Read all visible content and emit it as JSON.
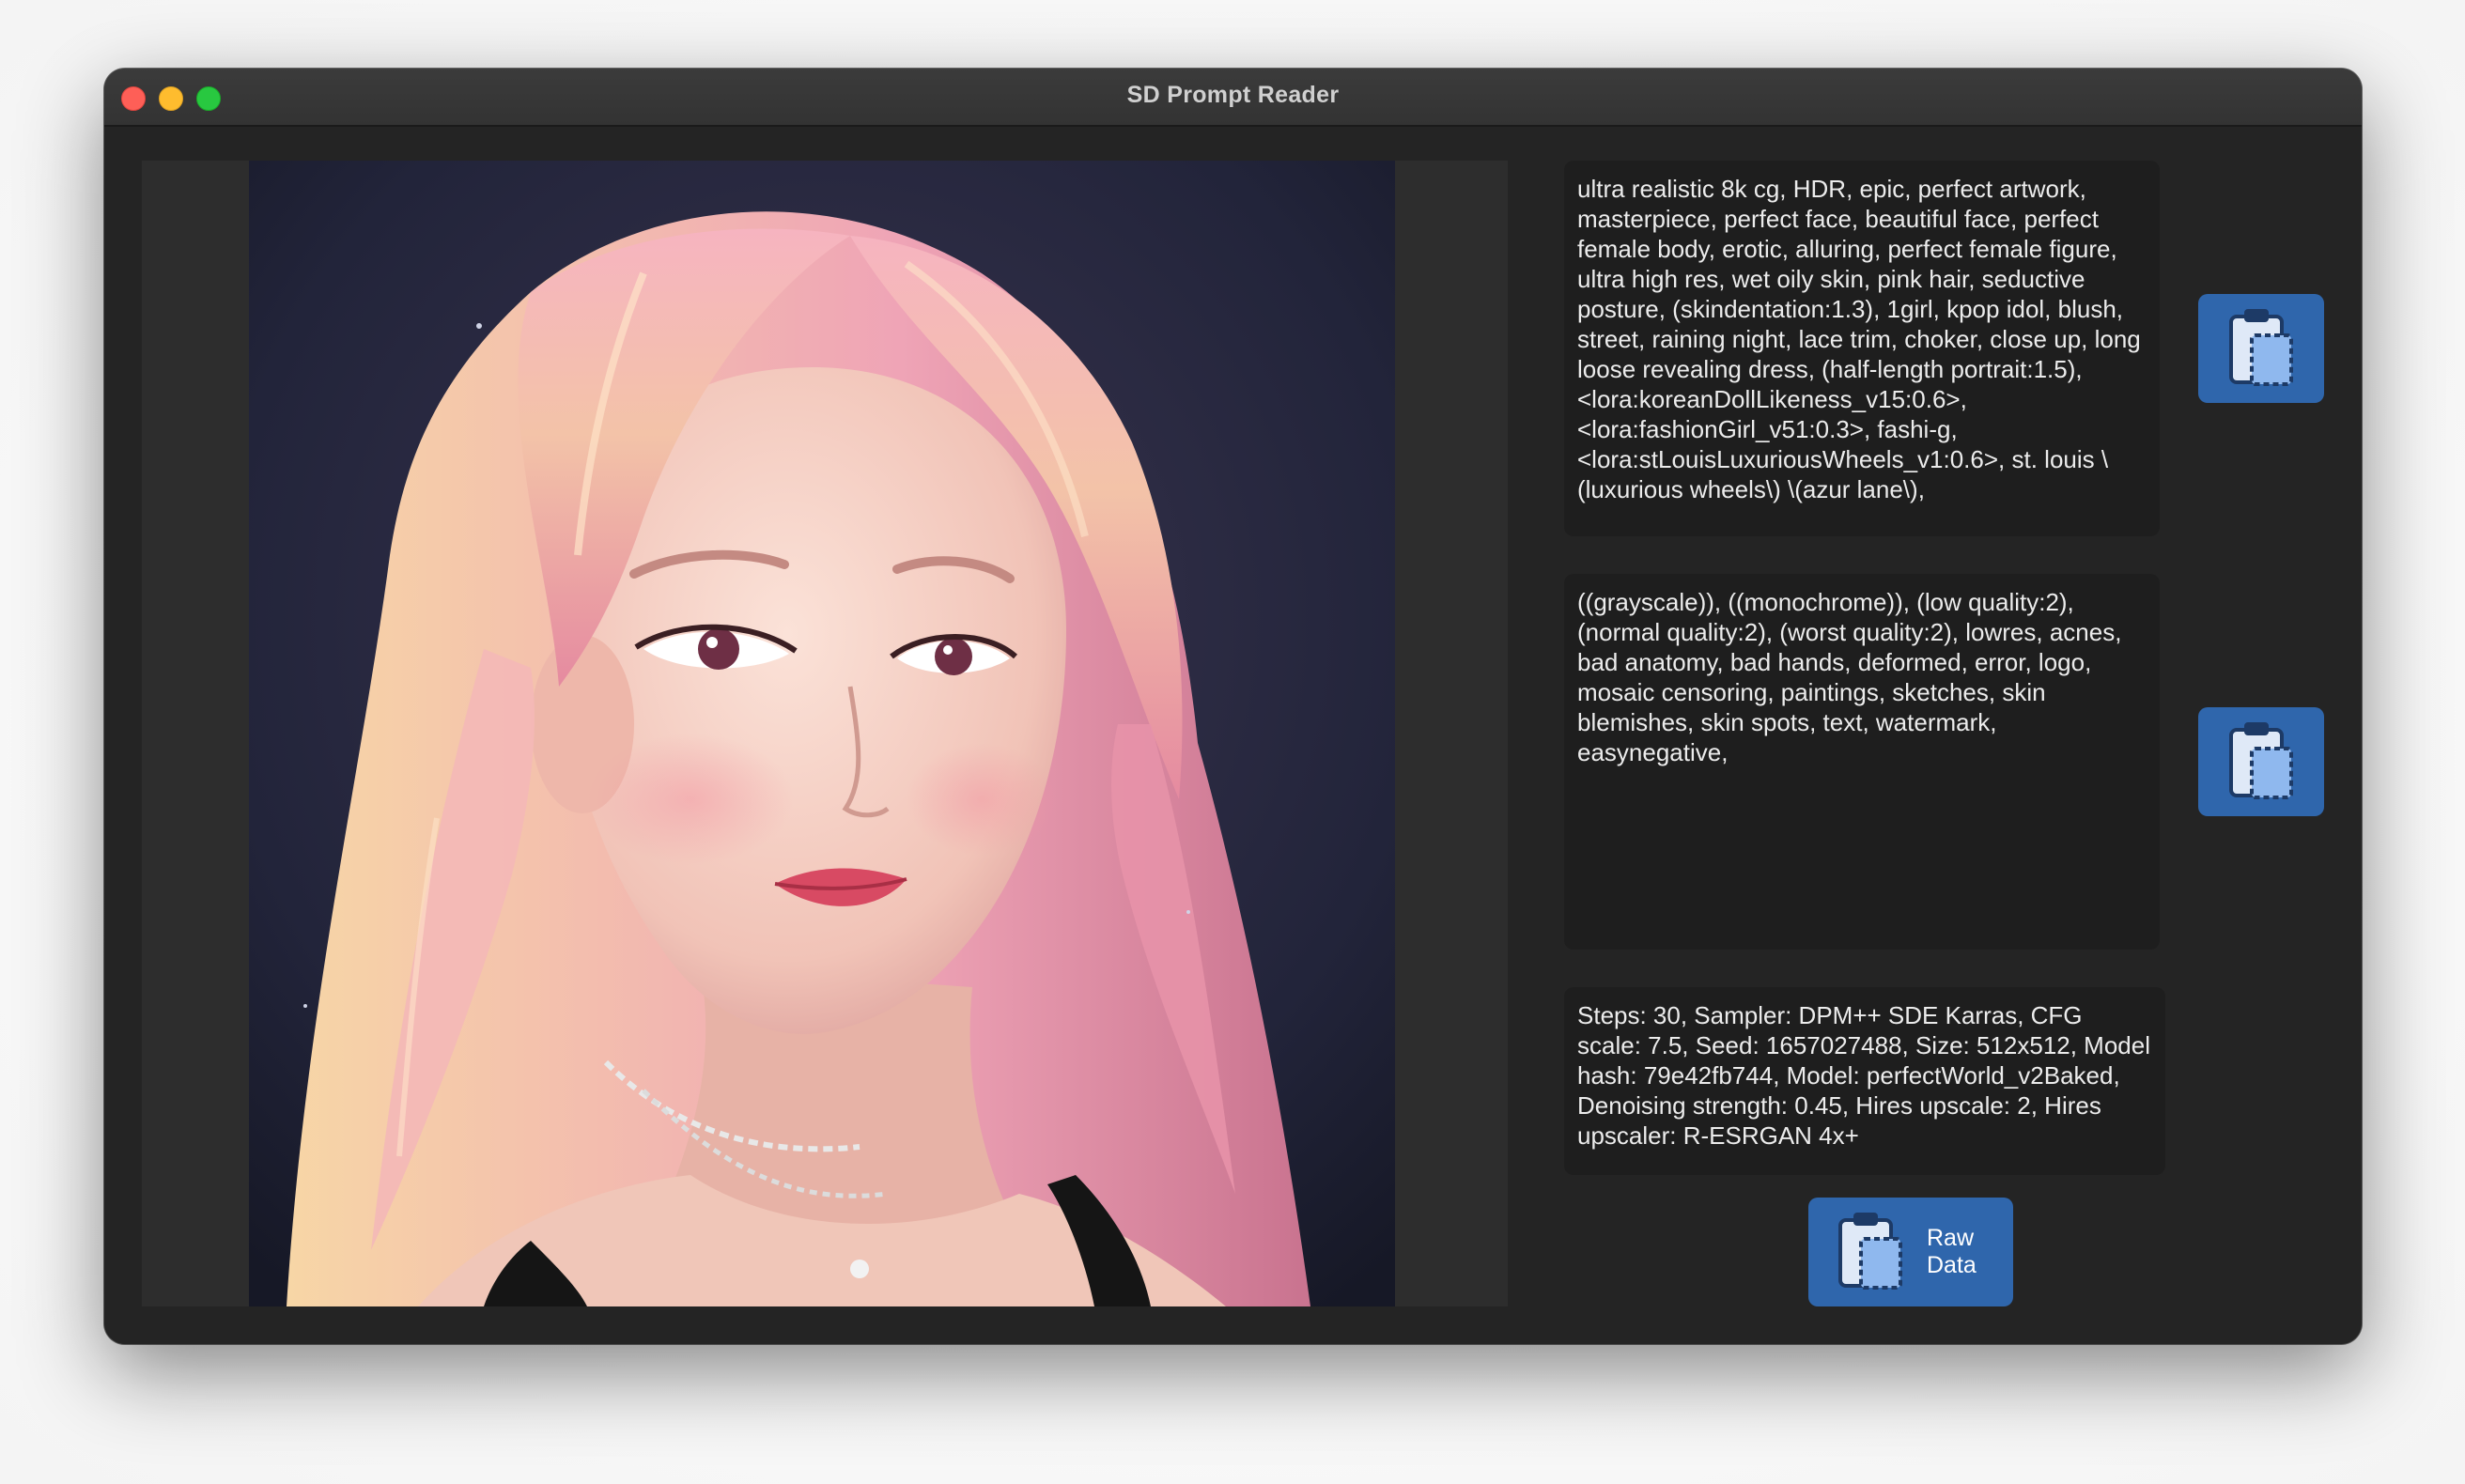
{
  "window": {
    "title": "SD Prompt Reader"
  },
  "image": {
    "description_icon": "portrait-image",
    "colors": {
      "background": "#1d1f2e",
      "hair": "#f2a4b4",
      "skin": "#f5cfc4"
    }
  },
  "prompts": {
    "positive": "ultra realistic 8k cg, HDR, epic, perfect artwork, masterpiece, perfect face, beautiful face, perfect female body, erotic, alluring, perfect female figure, ultra high res, wet oily skin, pink hair, seductive posture, (skindentation:1.3), 1girl, kpop idol, blush, street, raining night, lace trim, choker, close up, long loose revealing dress, (half-length portrait:1.5), <lora:koreanDollLikeness_v15:0.6>, <lora:fashionGirl_v51:0.3>, fashi-g, <lora:stLouisLuxuriousWheels_v1:0.6>, st. louis \\(luxurious wheels\\) \\(azur lane\\),",
    "negative": "((grayscale)), ((monochrome)), (low quality:2), (normal quality:2), (worst quality:2), lowres, acnes, bad anatomy, bad hands, deformed, error, logo, mosaic censoring, paintings, sketches, skin blemishes, skin spots, text, watermark, easynegative,",
    "settings": "Steps: 30, Sampler: DPM++ SDE Karras, CFG scale: 7.5, Seed: 1657027488, Size: 512x512, Model hash: 79e42fb744, Model: perfectWorld_v2Baked, Denoising strength: 0.45, Hires upscale: 2, Hires upscaler: R-ESRGAN 4x+"
  },
  "buttons": {
    "copy_positive_icon": "clipboard-copy-icon",
    "copy_negative_icon": "clipboard-copy-icon",
    "raw_data_label": "Raw Data",
    "raw_data_icon": "clipboard-copy-icon"
  },
  "colors": {
    "window_bg": "#242424",
    "textbox_bg": "#1e1e1e",
    "accent_button": "#2f66ac"
  }
}
